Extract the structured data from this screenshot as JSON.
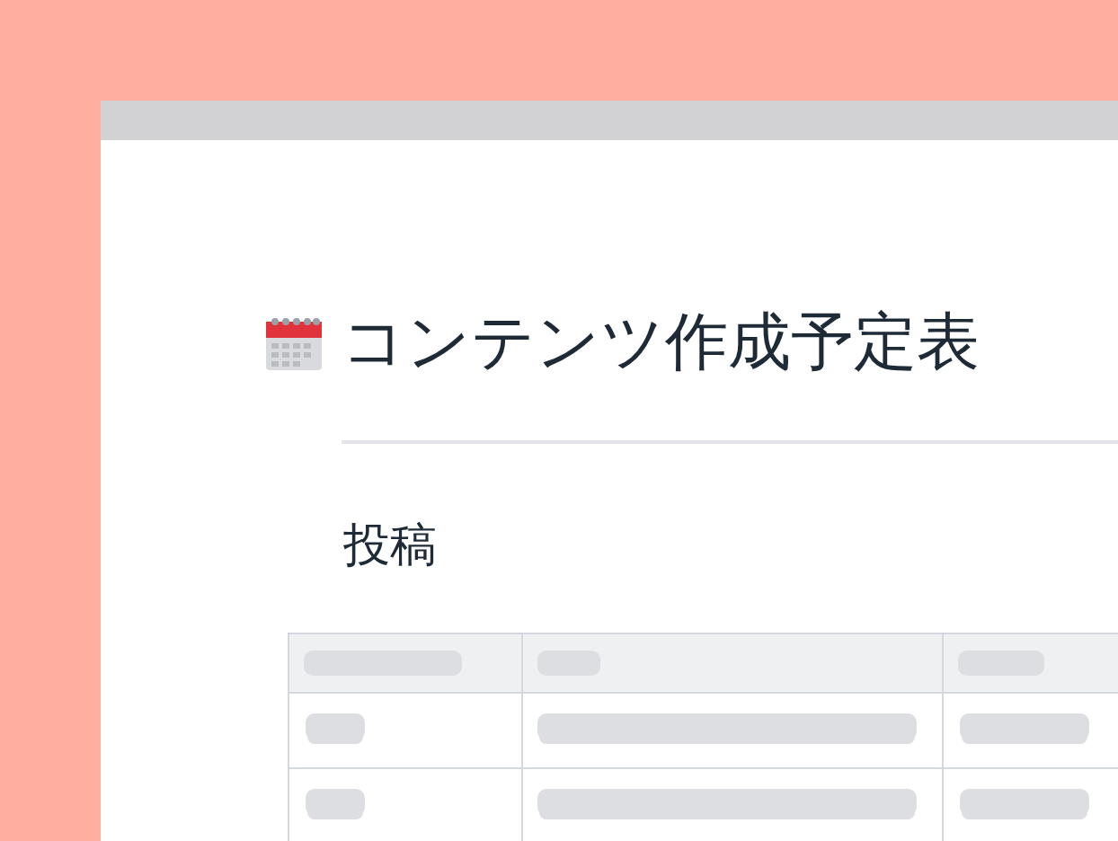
{
  "page": {
    "title": "コンテンツ作成予定表",
    "section_heading": "投稿"
  }
}
